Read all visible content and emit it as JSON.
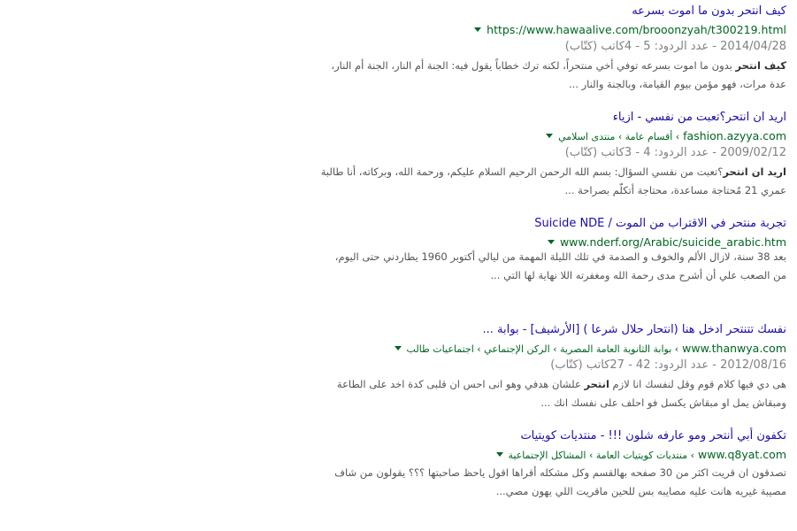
{
  "results": [
    {
      "title": "كيف انتحر بدون ما اموت بسرعه",
      "url": "https://www.hawaalive.com/brooonzyah/t300219.html",
      "crumbs": "",
      "date": "2014/04/28",
      "replies_label": "- عدد الردود:",
      "replies": "5",
      "sep": "-",
      "writers_count": "4",
      "writers_label": "كاتب (كتّاب)",
      "snippet_bold": "كيف انتحر",
      "snippet_rest": "بدون ما اموت بسرعه توفي أخي منتحراً، لكنه ترك خطاباً يقول فيه: الجنة أم النار، الجنة أم النار،",
      "snippet_line2": "عدة مرات، فهو مؤمن بيوم القيامة، وبالجنة والنار ..."
    },
    {
      "title": "اريد ان انتحر؟تعبت من نفسي - ازياء",
      "url": "fashion.azyya.com",
      "crumbs": "› أقسام عامة › منتدى اسلامي",
      "date": "2009/02/12",
      "replies_label": "- عدد الردود:",
      "replies": "4",
      "sep": "-",
      "writers_count": "3",
      "writers_label": "كاتب (كتّاب)",
      "snippet_bold": "اريد ان انتحر",
      "snippet_rest": "؟تعبت من نفسي السؤال: بسم الله الرحمن الرحيم السلام عليكم، ورحمة الله، وبركاته، أنا طالبة",
      "snippet_line2": "عمري 21 مُحتاجة مساعدة، محتاجة أتكلّم بصراحة ..."
    },
    {
      "title": "تجربة منتحر في الاقتراب من الموت / Suicide NDE",
      "url": "www.nderf.org/Arabic/suicide_arabic.htm",
      "crumbs": "",
      "date": "",
      "replies_label": "",
      "replies": "",
      "sep": "",
      "writers_count": "",
      "writers_label": "",
      "snippet_bold": "",
      "snippet_rest": "بعد 38 سنة، لازال الألم والخوف و الصدمة في تلك الليلة المهمة من ليالي أكتوبر 1960 يطاردني حتى اليوم،",
      "snippet_line2": "من الصعب علي أن أشرح مدى رحمة الله ومغفرته اللا نهاية لها التي ..."
    },
    {
      "title": "نفسك تتنتحر ادخل هنا (انتحار حلال شرعا ) [الأرشيف] - بوابة ...",
      "url": "www.thanwya.com",
      "crumbs": "› بوابة الثانوية العامة المصرية › الركن الإجتماعي › اجتماعيات طالب",
      "date": "2012/08/16",
      "replies_label": "- عدد الردود:",
      "replies": "42",
      "sep": "-",
      "writers_count": "27",
      "writers_label": "كاتب (كتّاب)",
      "snippet_bold": "انتحر",
      "snippet_pre": "هى دي فيها كلام قوم وقل لنفسك انا لازم",
      "snippet_rest": "علشان هدفي وهو انى احس ان قلبى كدة اخد على الطاعة",
      "snippet_line2": "ومبقاش يمل او مبقاش يكسل فو احلف على نفسك انك ..."
    },
    {
      "title": "تكفون أبي أنتحر ومو عارفه شلون !!! - منتديات كويتيات",
      "url": "www.q8yat.com",
      "crumbs": "› منتديات كويتيات العامة › المشاكل الإجتماعية",
      "date": "",
      "replies_label": "",
      "replies": "",
      "sep": "",
      "writers_count": "",
      "writers_label": "",
      "snippet_bold": "",
      "snippet_rest": "تصدقون ان قريت اكثر من 30 صفحه بهالقسم وكل مشكله أقراها اقول ياحظ صاحبتها ؟؟؟ يقولون من شاف",
      "snippet_line2": "مصيبة غيريه هانت عليه مصايبه بس للحين ماقريت اللي يهون مصي..."
    }
  ]
}
